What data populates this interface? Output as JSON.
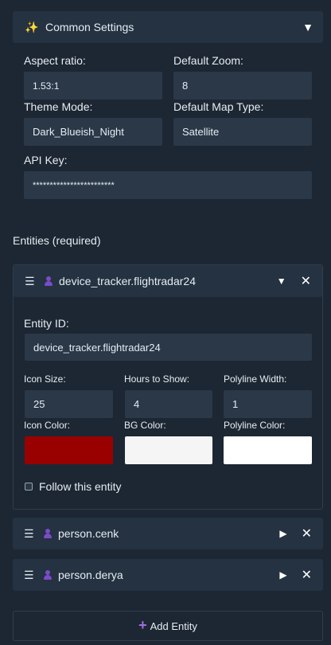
{
  "common": {
    "title": "Common Settings",
    "icon": "sparkle-icon",
    "aspect_ratio_label": "Aspect ratio:",
    "aspect_ratio_value": "1.53:1",
    "default_zoom_label": "Default Zoom:",
    "default_zoom_value": "8",
    "theme_mode_label": "Theme Mode:",
    "theme_mode_value": "Dark_Blueish_Night",
    "map_type_label": "Default Map Type:",
    "map_type_value": "Satellite",
    "api_key_label": "API Key:",
    "api_key_value": "************************"
  },
  "entities": {
    "section_title": "Entities (required)",
    "expanded": {
      "name": "device_tracker.flightradar24",
      "entity_id_label": "Entity ID:",
      "entity_id_value": "device_tracker.flightradar24",
      "icon_size_label": "Icon Size:",
      "icon_size_value": "25",
      "hours_label": "Hours to Show:",
      "hours_value": "4",
      "polyline_width_label": "Polyline Width:",
      "polyline_width_value": "1",
      "icon_color_label": "Icon Color:",
      "icon_color": "#990000",
      "bg_color_label": "BG Color:",
      "bg_color": "#f5f5f5",
      "polyline_color_label": "Polyline Color:",
      "polyline_color": "#ffffff",
      "follow_label": "Follow this entity",
      "follow_checked": false
    },
    "collapsed": [
      {
        "name": "person.cenk"
      },
      {
        "name": "person.derya"
      }
    ]
  },
  "add_entity_label": "Add Entity",
  "colors": {
    "background": "#1c2733",
    "header": "#243241",
    "input": "#2a3848",
    "person_icon": "#7b4bc9"
  }
}
